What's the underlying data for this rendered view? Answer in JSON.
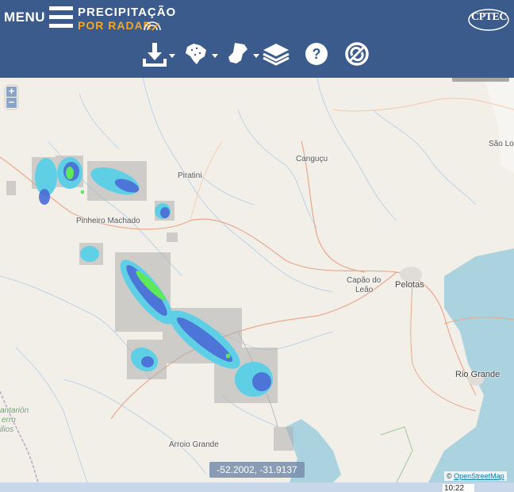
{
  "header": {
    "menu_label": "MENU",
    "brand_line1": "PRECIPITAÇÃO",
    "brand_line2": "POR RADAR",
    "logo_text": "CPTEC",
    "bg_color": "#3a5b8b",
    "accent_color": "#f5a623"
  },
  "toolbar": {
    "buttons": [
      {
        "icon": "download-icon",
        "has_dropdown": true
      },
      {
        "icon": "brazil-map-icon",
        "has_dropdown": true
      },
      {
        "icon": "state-map-icon",
        "has_dropdown": true
      },
      {
        "icon": "layers-icon",
        "has_dropdown": false
      },
      {
        "icon": "help-icon",
        "has_dropdown": false
      },
      {
        "icon": "no-sync-icon",
        "has_dropdown": false
      }
    ]
  },
  "map": {
    "zoom_in": "+",
    "zoom_out": "−",
    "places": {
      "sao_lourenco": "São Lo",
      "canguçu": "Canguçu",
      "piratini": "Piratini",
      "pinheiro_machado": "Pinheiro Machado",
      "capao_leao_1": "Capão do",
      "capao_leao_2": "Leão",
      "pelotas": "Pelotas",
      "rio_grande": "Rio Grande",
      "arroio_grande": "Arroio Grande",
      "pantanal_1": "antarión",
      "pantanal_2": "erro",
      "pantanal_3": "ilios"
    },
    "coordinates": "-52.2002, -31.9137",
    "attribution_prefix": "© ",
    "attribution_link": "OpenStreetMap"
  },
  "footer": {
    "time": "10:22"
  }
}
